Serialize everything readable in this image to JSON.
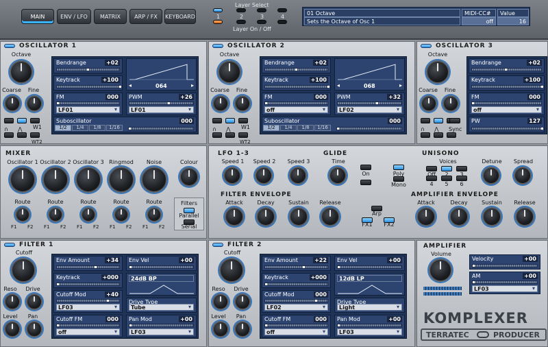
{
  "nav": {
    "tabs": [
      "MAIN",
      "ENV / LFO",
      "MATRIX",
      "ARP / FX",
      "KEYBOARD"
    ],
    "layer_select": "Layer Select",
    "layer_onoff": "Layer On / Off",
    "layers": [
      "1",
      "2",
      "3",
      "4"
    ]
  },
  "info": {
    "row1": "01 Octave",
    "row2": "Sets the Octave of Osc 1",
    "midi_head": "MIDI-CC#",
    "value_head": "Value",
    "midi_val": "off",
    "value_val": "16"
  },
  "osc": [
    {
      "title": "OSCILLATOR 1",
      "octave": "Octave",
      "coarse": "Coarse",
      "fine": "Fine",
      "bendrange": "Bendrange",
      "bend_val": "+02",
      "keytrack": "Keytrack",
      "key_val": "+100",
      "wave_val": "064",
      "fm": "FM",
      "fm_val": "000",
      "fm_sel": "LF01",
      "pwm": "PWM",
      "pwm_val": "+26",
      "pwm_sel": "LF01",
      "sub": "Suboscillator",
      "sub_val": "000",
      "sub_opts": [
        "1/2",
        "1/4",
        "1/8",
        "1/16"
      ],
      "w1": "W1",
      "w2": "WT2",
      "wave1": "∩",
      "wave2": "⋀"
    },
    {
      "title": "OSCILLATOR 2",
      "octave": "Octave",
      "coarse": "Coarse",
      "fine": "Fine",
      "bendrange": "Bendrange",
      "bend_val": "+02",
      "keytrack": "Keytrack",
      "key_val": "+100",
      "wave_val": "068",
      "fm": "FM",
      "fm_val": "000",
      "fm_sel": "off",
      "pwm": "PWM",
      "pwm_val": "+32",
      "pwm_sel": "LF02",
      "sub": "Suboscillator",
      "sub_val": "000",
      "sub_opts": [
        "1/2",
        "1/4",
        "1/8",
        "1/16"
      ],
      "w1": "W1",
      "w2": "WT2",
      "wave1": "∩",
      "wave2": "⋀"
    },
    {
      "title": "OSCILLATOR 3",
      "octave": "Octave",
      "coarse": "Coarse",
      "fine": "Fine",
      "bendrange": "Bendrange",
      "bend_val": "+02",
      "keytrack": "Keytrack",
      "key_val": "+100",
      "fm": "FM",
      "fm_val": "000",
      "fm_sel": "off",
      "pw": "PW",
      "pw_val": "127",
      "sync": "Sync",
      "wave1": "∩",
      "wave2": "⋀"
    }
  ],
  "mixer": {
    "title": "MIXER",
    "knobs": [
      "Oscillator 1",
      "Oscillator 2",
      "Oscillator 3",
      "Ringmod",
      "Noise"
    ],
    "colour": "Colour",
    "route": "Route",
    "f1": "F1",
    "f2": "F2",
    "filters": "Filters",
    "parallel": "Parallel",
    "serial": "Serial"
  },
  "lfo": {
    "title": "LFO 1-3",
    "speeds": [
      "Speed 1",
      "Speed 2",
      "Speed 3"
    ]
  },
  "glide": {
    "title": "GLIDE",
    "time": "Time",
    "on": "On",
    "poly": "Poly",
    "mono": "Mono"
  },
  "unisono": {
    "title": "UNISONO",
    "voices": "Voices",
    "voice_opts": [
      "Off",
      "2",
      "3",
      "4",
      "5",
      "6"
    ],
    "detune": "Detune",
    "spread": "Spread"
  },
  "fenv": {
    "title": "FILTER ENVELOPE",
    "knobs": [
      "Attack",
      "Decay",
      "Sustain",
      "Release"
    ],
    "arp": "Arp",
    "fx1": "FX1",
    "fx2": "FX2"
  },
  "aenv": {
    "title": "AMPLIFIER ENVELOPE",
    "knobs": [
      "Attack",
      "Decay",
      "Sustain",
      "Release"
    ]
  },
  "filt": [
    {
      "title": "FILTER 1",
      "cutoff": "Cutoff",
      "reso": "Reso",
      "drive": "Drive",
      "level": "Level",
      "pan": "Pan",
      "env_amount": "Env Amount",
      "env_amount_val": "+34",
      "env_vel": "Env Vel",
      "env_vel_val": "+00",
      "keytrack": "Keytrack",
      "key_val": "+000",
      "type_sel": "24dB BP",
      "cutoff_mod": "Cutoff Mod",
      "cm_val": "+40",
      "cm_sel": "LF03",
      "drive_type": "Drive Type",
      "dt_sel": "Tube",
      "cutoff_fm": "Cutoff FM",
      "cfm_val": "000",
      "cfm_sel": "off",
      "pan_mod": "Pan Mod",
      "pm_val": "+00",
      "pm_sel": "LF03"
    },
    {
      "title": "FILTER 2",
      "cutoff": "Cutoff",
      "reso": "Reso",
      "drive": "Drive",
      "level": "Level",
      "pan": "Pan",
      "env_amount": "Env Amount",
      "env_amount_val": "+22",
      "env_vel": "Env Vel",
      "env_vel_val": "+00",
      "keytrack": "Keytrack",
      "key_val": "+000",
      "type_sel": "12dB LP",
      "cutoff_mod": "Cutoff Mod",
      "cm_val": "000",
      "cm_sel": "LF02",
      "drive_type": "Drive Type",
      "dt_sel": "Light",
      "cutoff_fm": "Cutoff FM",
      "cfm_val": "000",
      "cfm_sel": "off",
      "pan_mod": "Pan Mod",
      "pm_val": "+00",
      "pm_sel": "LF03"
    }
  ],
  "amp": {
    "title": "AMPLIFIER",
    "volume": "Volume",
    "velocity": "Velocity",
    "vel_val": "+00",
    "am": "AM",
    "am_val": "+00",
    "am_sel": "LF03"
  },
  "brand": {
    "product": "KOMPLEXER",
    "maker": "TERRATEC",
    "line": "PRODUCER"
  }
}
